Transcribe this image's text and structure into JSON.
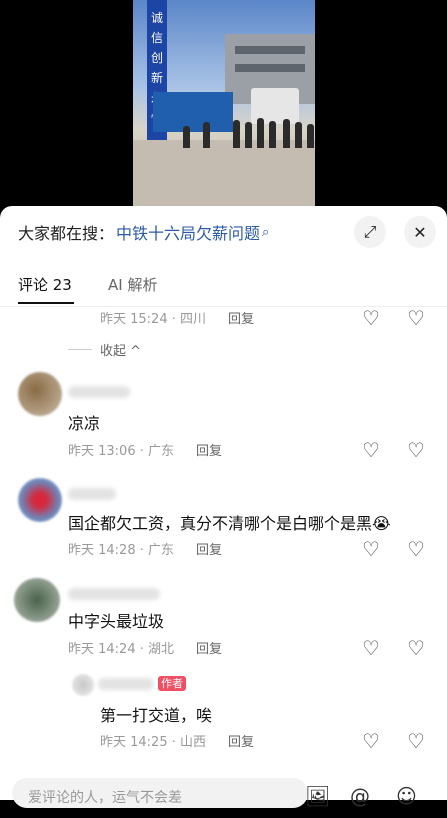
{
  "video": {
    "sign_text": "诚信创新永恒"
  },
  "header": {
    "search_prefix": "大家都在搜：",
    "search_query": "中铁十六局欠薪问题",
    "search_glyph": "⌕",
    "fullscreen_glyph": "⤢",
    "close_glyph": "✕"
  },
  "tabs": [
    {
      "label": "评论 23"
    },
    {
      "label": "AI 解析"
    }
  ],
  "collapse_label": "收起 ^",
  "reply_label": "回复",
  "author_badge": "作者",
  "comments": [
    {
      "text": "",
      "meta": "昨天 15:24 · 四川"
    },
    {
      "text": "凉凉",
      "meta": "昨天 13:06 · 广东"
    },
    {
      "text": "国企都欠工资，真分不清哪个是白哪个是黑😭",
      "meta": "昨天 14:28 · 广东"
    },
    {
      "text": "中字头最垃圾",
      "meta": "昨天 14:24 · 湖北"
    },
    {
      "text": "第一打交道，唉",
      "meta": "昨天 14:25 · 山西"
    }
  ],
  "input": {
    "placeholder": "爱评论的人，运气不会差"
  },
  "icons": {
    "heart": "♡",
    "dislike": "♡",
    "image": "🖼",
    "at": "@",
    "emoji": "☺"
  }
}
